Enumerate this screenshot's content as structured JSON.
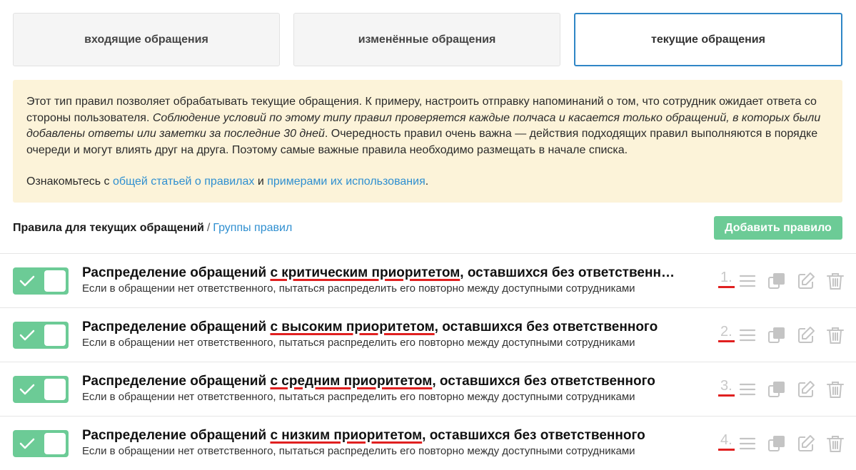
{
  "tabs": [
    {
      "label": "входящие обращения"
    },
    {
      "label": "изменённые обращения"
    },
    {
      "label": "текущие обращения"
    }
  ],
  "info": {
    "p1_plain": "Этот тип правил позволяет обрабатывать текущие обращения. К примеру, настроить отправку напоминаний о том, что сотрудник ожидает ответа со стороны пользователя. ",
    "p1_italic": "Соблюдение условий по этому типу правил проверяется каждые полчаса и касается только обращений, в которых были добавлены ответы или заметки за последние 30 дней",
    "p1_tail": ". Очередность правил очень важна — действия подходящих правил выполняются в порядке очереди и могут влиять друг на друга. Поэтому самые важные правила необходимо размещать в начале списка.",
    "p2_prefix": "Ознакомьтесь с ",
    "link1": "общей статьей о правилах",
    "p2_and": " и ",
    "link2": "примерами их использования",
    "p2_end": "."
  },
  "header": {
    "current": "Правила для текущих обращений",
    "separator": "/",
    "groups_link": "Группы правил",
    "add_button": "Добавить правило"
  },
  "rules": [
    {
      "title_a": "Распределение обращений ",
      "title_hl": "с критическим приоритетом",
      "title_b": ", оставшихся без ответственного",
      "desc": "Если в обращении нет ответственного, пытаться распределить его повторно между доступными сотрудниками",
      "order": "1."
    },
    {
      "title_a": "Распределение обращений ",
      "title_hl": "с высоким приоритетом",
      "title_b": ", оставшихся без ответственного",
      "desc": "Если в обращении нет ответственного, пытаться распределить его повторно между доступными сотрудниками",
      "order": "2."
    },
    {
      "title_a": "Распределение обращений ",
      "title_hl": "с средним приоритетом",
      "title_b": ", оставшихся без ответственного",
      "desc": "Если в обращении нет ответственного, пытаться распределить его повторно между доступными сотрудниками",
      "order": "3."
    },
    {
      "title_a": "Распределение обращений ",
      "title_hl": "с низким приоритетом",
      "title_b": ", оставшихся без ответственного",
      "desc": "Если в обращении нет ответственного, пытаться распределить его повторно между доступными сотрудниками",
      "order": "4."
    }
  ],
  "colors": {
    "accent": "#2f86c6",
    "toggle_on": "#6ccb96",
    "info_bg": "#fcf3d9",
    "underline": "#e02020"
  },
  "icons": [
    "check-icon",
    "drag-handle-icon",
    "copy-icon",
    "edit-icon",
    "trash-icon"
  ]
}
